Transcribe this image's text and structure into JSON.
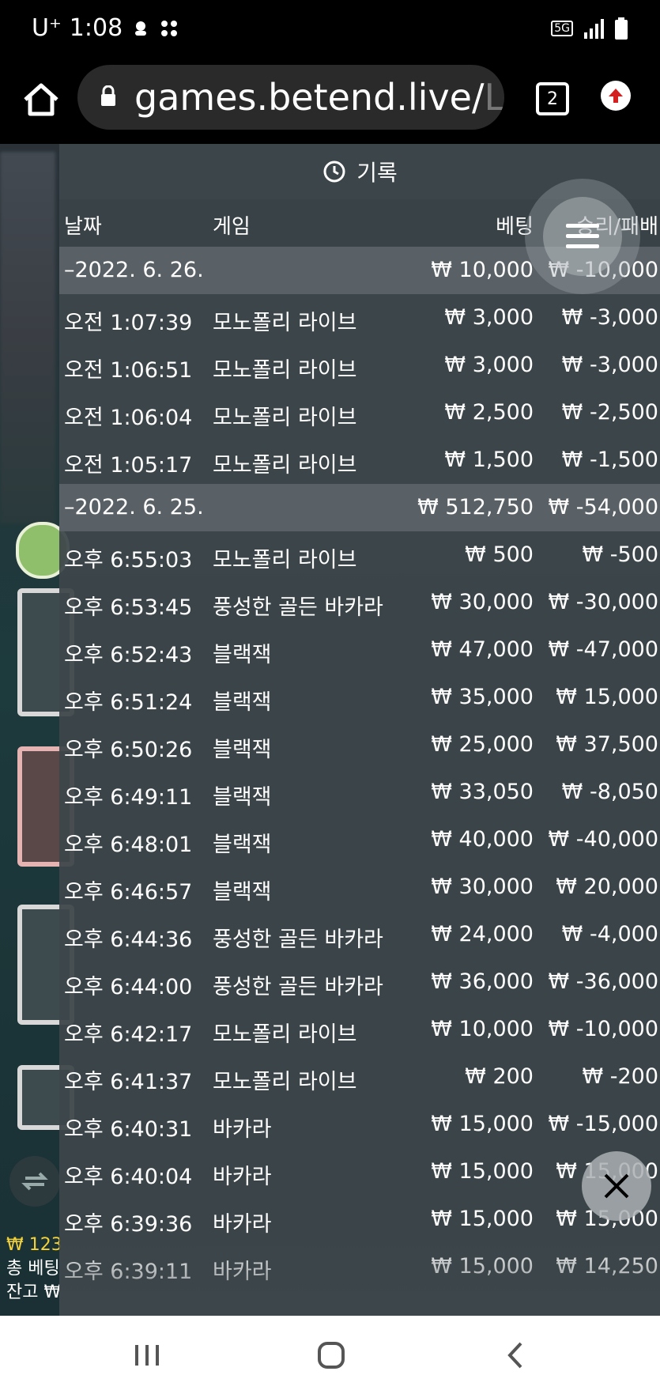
{
  "status_bar": {
    "carrier": "U⁺",
    "time": "1:08",
    "network": "5G"
  },
  "browser": {
    "url_main": "games.betend.live/",
    "url_tail": "Lo",
    "tab_count": "2"
  },
  "panel": {
    "title": "기록",
    "columns": {
      "date": "날짜",
      "game": "게임",
      "bet": "베팅",
      "result": "승리/패배"
    }
  },
  "groups": [
    {
      "date": "–2022. 6. 26.",
      "bet_total": "₩ 10,000",
      "result_total": "₩ -10,000",
      "rows": [
        {
          "time": "오전 1:07:39",
          "game": "모노폴리 라이브",
          "bet": "₩ 3,000",
          "result": "₩ -3,000"
        },
        {
          "time": "오전 1:06:51",
          "game": "모노폴리 라이브",
          "bet": "₩ 3,000",
          "result": "₩ -3,000"
        },
        {
          "time": "오전 1:06:04",
          "game": "모노폴리 라이브",
          "bet": "₩ 2,500",
          "result": "₩ -2,500"
        },
        {
          "time": "오전 1:05:17",
          "game": "모노폴리 라이브",
          "bet": "₩ 1,500",
          "result": "₩ -1,500"
        }
      ]
    },
    {
      "date": "–2022. 6. 25.",
      "bet_total": "₩ 512,750",
      "result_total": "₩ -54,000",
      "rows": [
        {
          "time": "오후 6:55:03",
          "game": "모노폴리 라이브",
          "bet": "₩ 500",
          "result": "₩ -500"
        },
        {
          "time": "오후 6:53:45",
          "game": "풍성한 골든 바카라",
          "bet": "₩ 30,000",
          "result": "₩ -30,000"
        },
        {
          "time": "오후 6:52:43",
          "game": "블랙잭",
          "bet": "₩ 47,000",
          "result": "₩ -47,000"
        },
        {
          "time": "오후 6:51:24",
          "game": "블랙잭",
          "bet": "₩ 35,000",
          "result": "₩ 15,000"
        },
        {
          "time": "오후 6:50:26",
          "game": "블랙잭",
          "bet": "₩ 25,000",
          "result": "₩ 37,500"
        },
        {
          "time": "오후 6:49:11",
          "game": "블랙잭",
          "bet": "₩ 33,050",
          "result": "₩ -8,050"
        },
        {
          "time": "오후 6:48:01",
          "game": "블랙잭",
          "bet": "₩ 40,000",
          "result": "₩ -40,000"
        },
        {
          "time": "오후 6:46:57",
          "game": "블랙잭",
          "bet": "₩ 30,000",
          "result": "₩ 20,000"
        },
        {
          "time": "오후 6:44:36",
          "game": "풍성한 골든 바카라",
          "bet": "₩ 24,000",
          "result": "₩ -4,000"
        },
        {
          "time": "오후 6:44:00",
          "game": "풍성한 골든 바카라",
          "bet": "₩ 36,000",
          "result": "₩ -36,000"
        },
        {
          "time": "오후 6:42:17",
          "game": "모노폴리 라이브",
          "bet": "₩ 10,000",
          "result": "₩ -10,000"
        },
        {
          "time": "오후 6:41:37",
          "game": "모노폴리 라이브",
          "bet": "₩ 200",
          "result": "₩ -200"
        },
        {
          "time": "오후 6:40:31",
          "game": "바카라",
          "bet": "₩ 15,000",
          "result": "₩ -15,000"
        },
        {
          "time": "오후 6:40:04",
          "game": "바카라",
          "bet": "₩ 15,000",
          "result": "₩ 15,000"
        },
        {
          "time": "오후 6:39:36",
          "game": "바카라",
          "bet": "₩ 15,000",
          "result": "₩ 15,000"
        },
        {
          "time": "오후 6:39:11",
          "game": "바카라",
          "bet": "₩ 15,000",
          "result": "₩ 14,250"
        }
      ]
    }
  ],
  "background": {
    "balance_prefix": "₩ 123",
    "total_bet_label": "총 베팅",
    "balance_label": "잔고 ₩"
  },
  "colors": {
    "panel_bg": "#3e464a",
    "date_row_bg": "#5a6166",
    "header_bg": "#394246"
  }
}
